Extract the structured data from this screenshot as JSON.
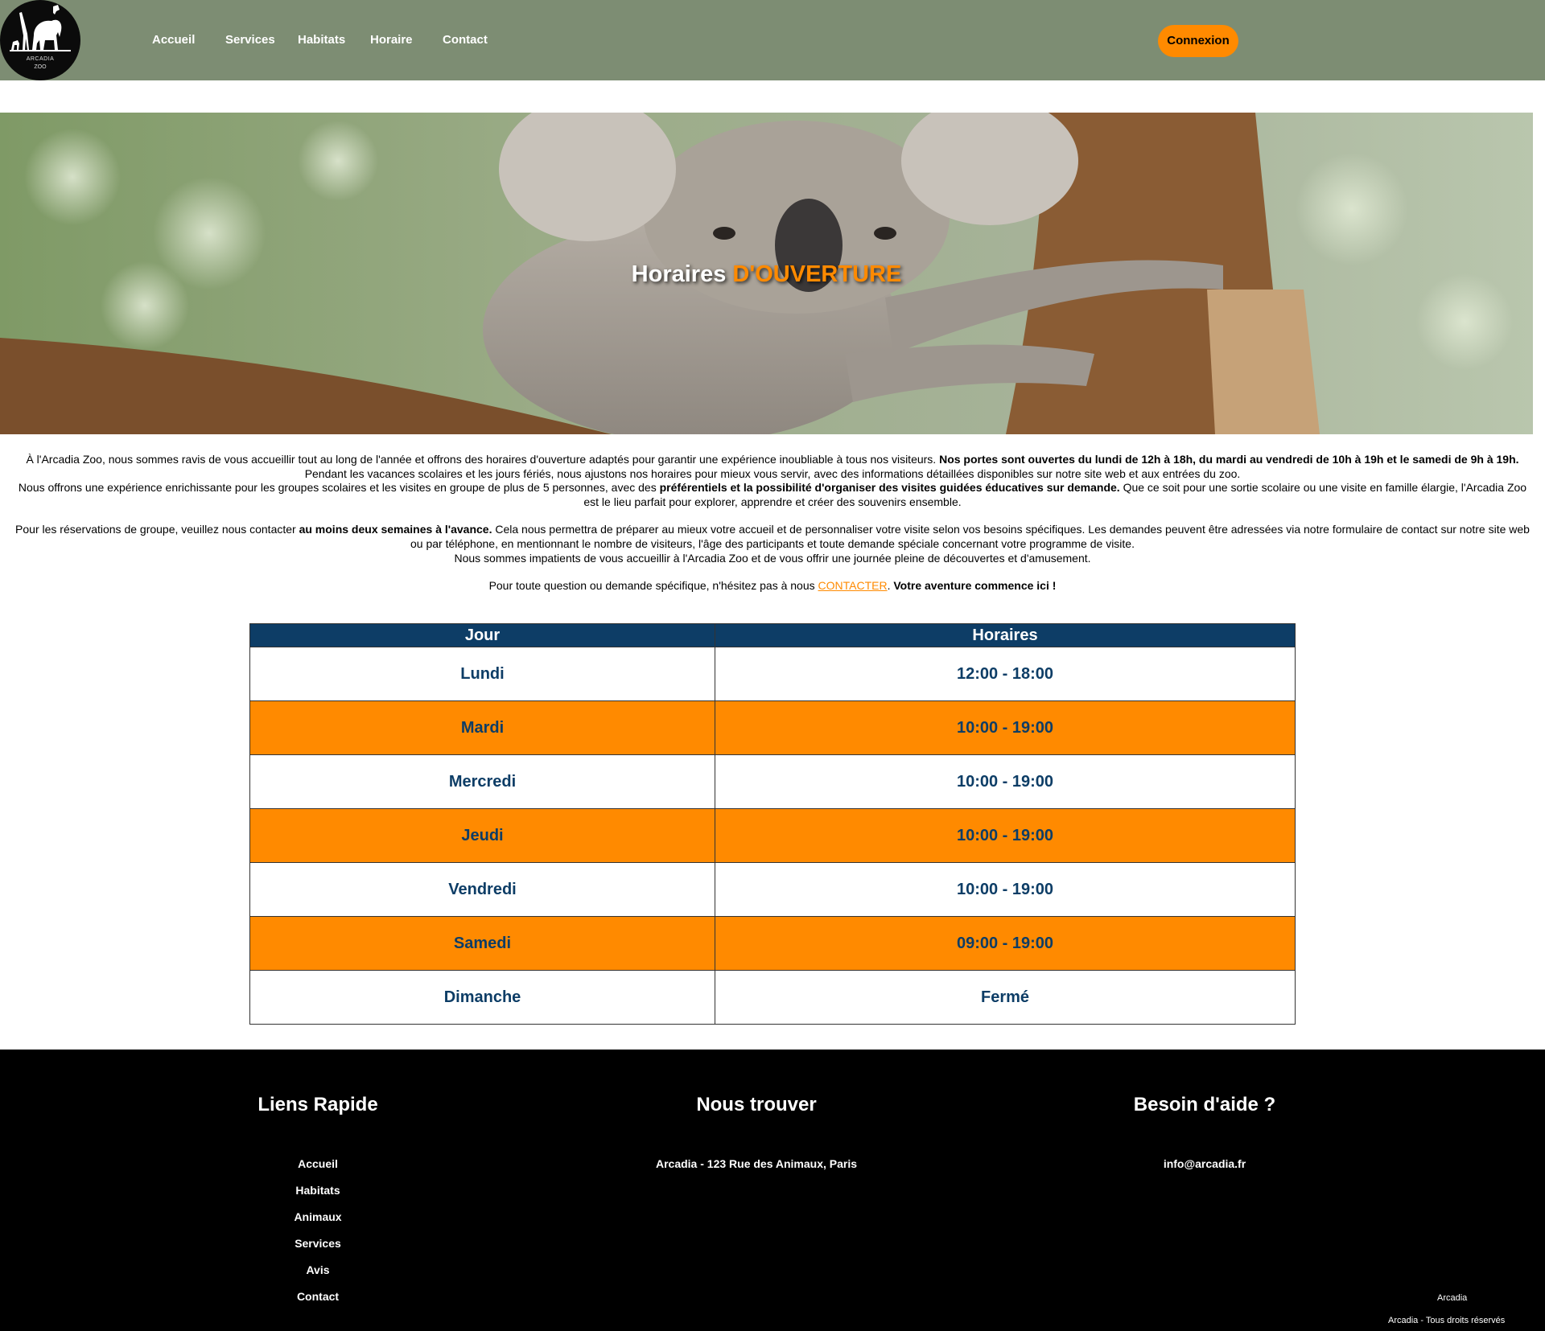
{
  "colors": {
    "nav_bg": "#7d8d73",
    "accent": "#ff8a00",
    "table_header": "#0d3d66",
    "footer_bg": "#000000"
  },
  "logo": {
    "line1": "ARCADIA",
    "line2": "ZOO",
    "icon": "elephant-giraffe-logo-icon"
  },
  "nav": {
    "links": [
      "Accueil",
      "Services",
      "Habitats",
      "Horaire",
      "Contact"
    ],
    "login": "Connexion"
  },
  "hero": {
    "title_main": "Horaires ",
    "title_accent": "D'OUVERTURE"
  },
  "intro": {
    "p1_text": "À l'Arcadia Zoo, nous sommes ravis de vous accueillir tout au long de l'année et offrons des horaires d'ouverture adaptés pour garantir une expérience inoubliable à tous nos visiteurs. ",
    "p1_bold": "Nos portes sont ouvertes du lundi de 12h à 18h, du mardi au vendredi de 10h à 19h et le samedi de 9h à 19h.",
    "p2": "Pendant les vacances scolaires et les jours fériés, nous ajustons nos horaires pour mieux vous servir, avec des informations détaillées disponibles sur notre site web et aux entrées du zoo.",
    "p3_a": "Nous offrons une expérience enrichissante pour les groupes scolaires et les visites en groupe de plus de 5 personnes, avec des ",
    "p3_bold": "préférentiels et la possibilité d'organiser des visites guidées éducatives sur demande.",
    "p3_b": " Que ce soit pour une sortie scolaire ou une visite en famille élargie, l'Arcadia Zoo est le lieu parfait pour explorer, apprendre et créer des souvenirs ensemble.",
    "p4_a": "Pour les réservations de groupe, veuillez nous contacter ",
    "p4_bold": "au moins deux semaines à l'avance.",
    "p4_b": " Cela nous permettra de préparer au mieux votre accueil et de personnaliser votre visite selon vos besoins spécifiques. Les demandes peuvent être adressées via notre formulaire de contact sur notre site web ou par téléphone, en mentionnant le nombre de visiteurs, l'âge des participants et toute demande spéciale concernant votre programme de visite.",
    "p5": "Nous sommes impatients de vous accueillir à l'Arcadia Zoo et de vous offrir une journée pleine de découvertes et d'amusement.",
    "p6_a": "Pour toute question ou demande spécifique, n'hésitez pas à nous ",
    "p6_link": "CONTACTER",
    "p6_b": ". ",
    "p6_bold": "Votre aventure commence ici !"
  },
  "table": {
    "headers": [
      "Jour",
      "Horaires"
    ],
    "rows": [
      {
        "day": "Lundi",
        "hours": "12:00 - 18:00"
      },
      {
        "day": "Mardi",
        "hours": "10:00 - 19:00"
      },
      {
        "day": "Mercredi",
        "hours": "10:00 - 19:00"
      },
      {
        "day": "Jeudi",
        "hours": "10:00 - 19:00"
      },
      {
        "day": "Vendredi",
        "hours": "10:00 - 19:00"
      },
      {
        "day": "Samedi",
        "hours": "09:00 - 19:00"
      },
      {
        "day": "Dimanche",
        "hours": "Fermé"
      }
    ]
  },
  "footer": {
    "quick_links_title": "Liens Rapide",
    "quick_links": [
      "Accueil",
      "Habitats",
      "Animaux",
      "Services",
      "Avis",
      "Contact"
    ],
    "find_us_title": "Nous trouver",
    "address": "Arcadia - 123 Rue des Animaux, Paris",
    "help_title": "Besoin d'aide ?",
    "email": "info@arcadia.fr",
    "copyright_1": "Arcadia",
    "copyright_2": "Arcadia - Tous droits réservés"
  }
}
